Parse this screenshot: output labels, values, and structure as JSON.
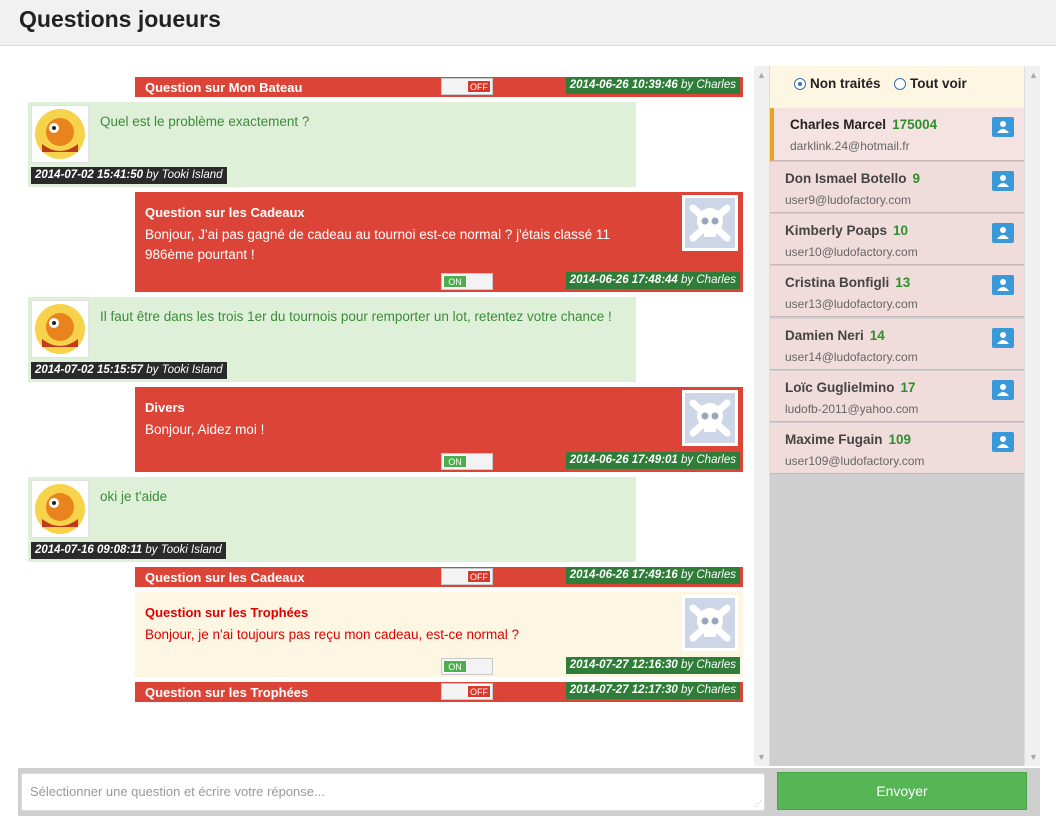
{
  "page": {
    "title": "Questions joueurs"
  },
  "feed": [
    {
      "kind": "question-collapsed",
      "title": "Question sur Mon Bateau",
      "toggle": "OFF",
      "date": "2014-06-26 10:39:46",
      "by": "by Charles"
    },
    {
      "kind": "answer",
      "text": "Quel est le problème exactement ?",
      "date": "2014-07-02 15:41:50",
      "by": "by Tooki Island"
    },
    {
      "kind": "question",
      "title": "Question sur les Cadeaux",
      "text": "Bonjour, J'ai pas gagné de cadeau au tournoi est-ce normal ? j'étais classé 11 986ème pourtant !",
      "toggle": "ON",
      "date": "2014-06-26 17:48:44",
      "by": "by Charles"
    },
    {
      "kind": "answer",
      "text": "Il faut être dans les trois 1er du tournois pour remporter un lot, retentez votre chance !",
      "date": "2014-07-02 15:15:57",
      "by": "by Tooki Island"
    },
    {
      "kind": "question",
      "title": "Divers",
      "text": "Bonjour, Aidez moi !",
      "toggle": "ON",
      "date": "2014-06-26 17:49:01",
      "by": "by Charles"
    },
    {
      "kind": "answer",
      "text": "oki je t'aide",
      "date": "2014-07-16 09:08:11",
      "by": "by Tooki Island"
    },
    {
      "kind": "question-collapsed",
      "title": "Question sur les Cadeaux",
      "toggle": "OFF",
      "date": "2014-06-26 17:49:16",
      "by": "by Charles"
    },
    {
      "kind": "question-pending",
      "title": "Question sur les Trophées",
      "text": "Bonjour, je n'ai toujours pas reçu mon cadeau, est-ce normal ?",
      "toggle": "ON",
      "date": "2014-07-27 12:16:30",
      "by": "by Charles"
    },
    {
      "kind": "question-collapsed",
      "title": "Question sur les Trophées",
      "toggle": "OFF",
      "date": "2014-07-27 12:17:30",
      "by": "by Charles"
    }
  ],
  "filter": {
    "option_untreated": "Non traités",
    "option_all": "Tout voir",
    "selected": "untreated"
  },
  "users": [
    {
      "name": "Charles Marcel",
      "count": "175004",
      "email": "darklink.24@hotmail.fr"
    },
    {
      "name": "Don Ismael Botello",
      "count": "9",
      "email": "user9@ludofactory.com"
    },
    {
      "name": "Kimberly Poaps",
      "count": "10",
      "email": "user10@ludofactory.com"
    },
    {
      "name": "Cristina Bonfigli",
      "count": "13",
      "email": "user13@ludofactory.com"
    },
    {
      "name": "Damien Neri",
      "count": "14",
      "email": "user14@ludofactory.com"
    },
    {
      "name": "Loïc Guglielmino",
      "count": "17",
      "email": "ludofb-2011@yahoo.com"
    },
    {
      "name": "Maxime Fugain",
      "count": "109",
      "email": "user109@ludofactory.com"
    }
  ],
  "composer": {
    "placeholder": "Sélectionner une question et écrire votre réponse...",
    "send_label": "Envoyer"
  },
  "colors": {
    "question_bg": "#db4437",
    "answer_bg": "#dff0d8",
    "pending_bg": "#fcf6e3",
    "stamp_bg": "#2f7d38",
    "send_bg": "#56b656",
    "user_bg": "#f1dcdc"
  }
}
